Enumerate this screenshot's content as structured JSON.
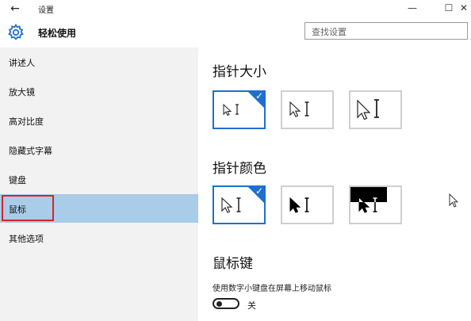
{
  "titlebar": {
    "back_glyph": "←",
    "title": "设置",
    "minimize_glyph": "—",
    "maximize_glyph": "☐",
    "close_glyph": "✕"
  },
  "header": {
    "icon": "gear-icon",
    "title": "轻松使用",
    "search_placeholder": "查找设置"
  },
  "sidebar": {
    "items": [
      {
        "label": "讲述人",
        "selected": false
      },
      {
        "label": "放大镜",
        "selected": false
      },
      {
        "label": "高对比度",
        "selected": false
      },
      {
        "label": "隐藏式字幕",
        "selected": false
      },
      {
        "label": "键盘",
        "selected": false
      },
      {
        "label": "鼠标",
        "selected": true
      },
      {
        "label": "其他选项",
        "selected": false
      }
    ]
  },
  "main": {
    "pointer_size": {
      "title": "指针大小",
      "options": [
        {
          "icon": "small-pointer-icon",
          "selected": true
        },
        {
          "icon": "medium-pointer-icon",
          "selected": false
        },
        {
          "icon": "large-pointer-icon",
          "selected": false
        }
      ]
    },
    "pointer_color": {
      "title": "指针颜色",
      "options": [
        {
          "icon": "white-pointer-icon",
          "selected": true
        },
        {
          "icon": "black-pointer-icon",
          "selected": false
        },
        {
          "icon": "inverted-pointer-icon",
          "selected": false
        }
      ]
    },
    "mouse_keys": {
      "title": "鼠标键",
      "description": "使用数字小键盘在屏幕上移动鼠标",
      "toggle_state": "关",
      "toggle_on": false
    }
  },
  "colors": {
    "accent": "#1f6fce",
    "sidebar_selected": "#a9cce8",
    "sidebar_bg": "#f2f2f2",
    "highlight_box": "#d8242a"
  }
}
